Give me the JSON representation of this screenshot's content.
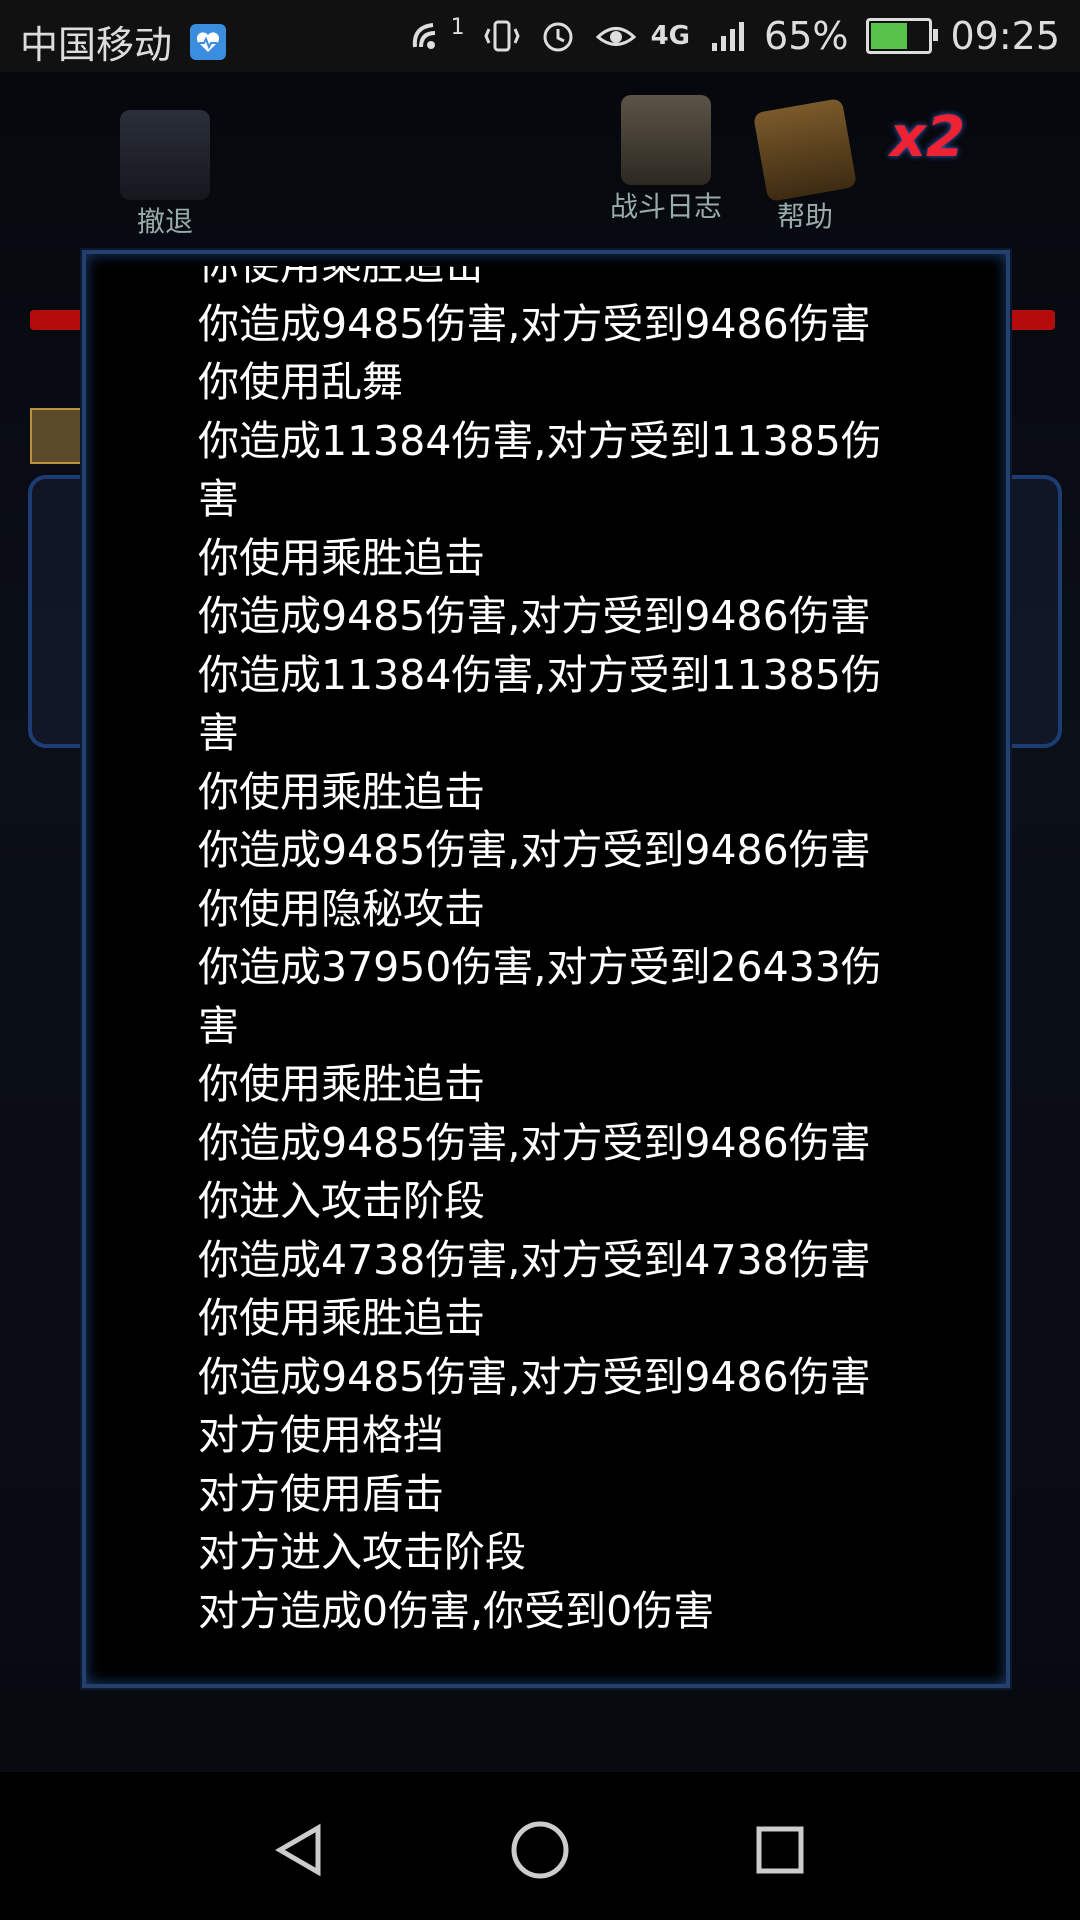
{
  "status_bar": {
    "carrier": "中国移动",
    "network_badge": "1",
    "network_type": "4G",
    "network_type_small": "4G",
    "battery_percent": "65%",
    "time": "09:25",
    "icons": [
      "health-icon",
      "wifi-call-icon",
      "vibrate-icon",
      "alarm-icon",
      "eye-icon",
      "signal-icon",
      "battery-icon"
    ]
  },
  "game_header": {
    "retreat_label": "撤退",
    "battle_log_label": "战斗日志",
    "help_label": "帮助",
    "speed_label": "x2"
  },
  "battle_log": {
    "lines": [
      "你使用乘胜追击",
      "你造成9485伤害,对方受到9486伤害",
      "你使用乱舞",
      "你造成11384伤害,对方受到11385伤害",
      "你使用乘胜追击",
      "你造成9485伤害,对方受到9486伤害",
      "你造成11384伤害,对方受到11385伤害",
      "你使用乘胜追击",
      "你造成9485伤害,对方受到9486伤害",
      "你使用隐秘攻击",
      "你造成37950伤害,对方受到26433伤害",
      "你使用乘胜追击",
      "你造成9485伤害,对方受到9486伤害",
      "你进入攻击阶段",
      "你造成4738伤害,对方受到4738伤害",
      "你使用乘胜追击",
      "你造成9485伤害,对方受到9486伤害",
      "对方使用格挡",
      "对方使用盾击",
      "对方进入攻击阶段",
      "对方造成0伤害,你受到0伤害"
    ]
  },
  "colors": {
    "dialog_border": "#24406d",
    "hp_bar": "#b40c0c",
    "battery_fill": "#59c24a"
  }
}
